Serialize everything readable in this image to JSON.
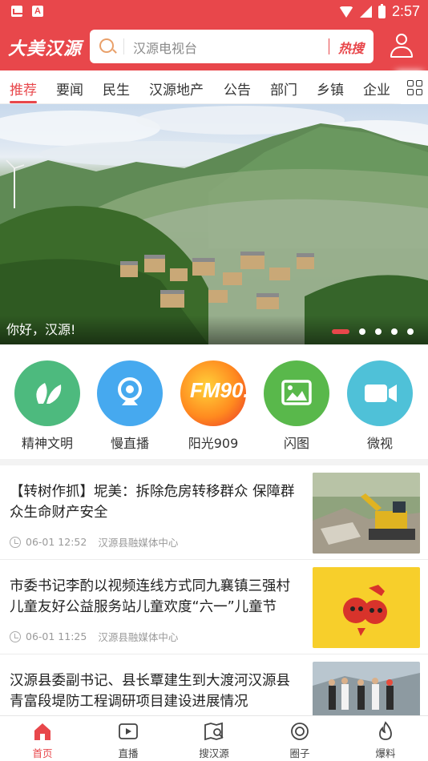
{
  "status_bar": {
    "time": "2:57"
  },
  "header": {
    "logo_text": "大美汉源",
    "search_placeholder": "汉源电视台",
    "hot_search_label": "热搜"
  },
  "tabs": [
    {
      "label": "推荐",
      "active": true
    },
    {
      "label": "要闻"
    },
    {
      "label": "民生"
    },
    {
      "label": "汉源地产"
    },
    {
      "label": "公告"
    },
    {
      "label": "部门"
    },
    {
      "label": "乡镇"
    },
    {
      "label": "企业"
    }
  ],
  "banner": {
    "caption": "你好，汉源!",
    "page_count": 5,
    "active_page": 1
  },
  "quick_entries": [
    {
      "label": "精神文明",
      "color": "#4dba7e",
      "icon": "leaf-icon"
    },
    {
      "label": "慢直播",
      "color": "#46a9ef",
      "icon": "webcam-icon"
    },
    {
      "label": "阳光909",
      "color": "#f25a1e",
      "icon": "radio-fm-logo",
      "logo_text": "FM90.9"
    },
    {
      "label": "闪图",
      "color": "#59b84b",
      "icon": "image-icon"
    },
    {
      "label": "微视",
      "color": "#4fc1d8",
      "icon": "video-camera-icon"
    }
  ],
  "news": [
    {
      "title": "【转树作抓】坭美：拆除危房转移群众 保障群众生命财产安全",
      "time": "06-01 12:52",
      "source": "汉源县融媒体中心"
    },
    {
      "title": "市委书记李酌以视频连线方式同九襄镇三强村儿童友好公益服务站儿童欢度“六一”儿童节",
      "time": "06-01 11:25",
      "source": "汉源县融媒体中心"
    },
    {
      "title": "汉源县委副书记、县长覃建生到大渡河汉源县青富段堤防工程调研项目建设进展情况",
      "time": "",
      "source": ""
    }
  ],
  "bottom_nav": [
    {
      "label": "首页",
      "active": true
    },
    {
      "label": "直播"
    },
    {
      "label": "搜汉源"
    },
    {
      "label": "圈子"
    },
    {
      "label": "爆料"
    }
  ],
  "colors": {
    "brand_red": "#e8474b"
  }
}
